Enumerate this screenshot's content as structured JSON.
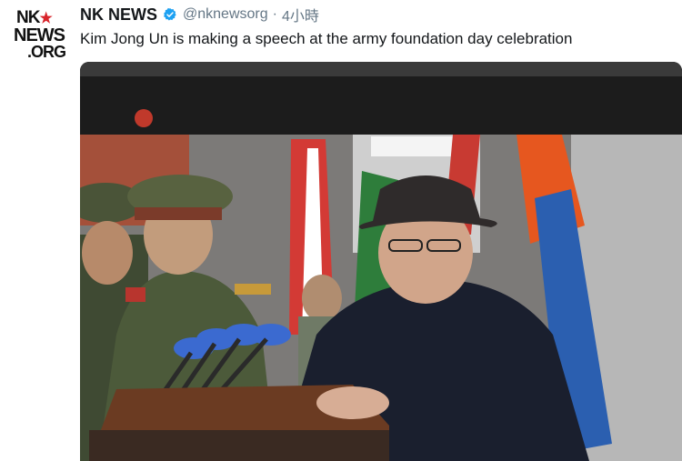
{
  "avatar": {
    "logo_line1": "NK",
    "logo_line2": "NEWS",
    "logo_line3": ".ORG",
    "star_color": "#d8242b"
  },
  "header": {
    "name": "NK NEWS",
    "handle": "@nknewsorg",
    "separator": "·",
    "time": "4小時",
    "verified_color": "#1da1f2"
  },
  "tweet": {
    "text": "Kim Jong Un is making a speech at the army foundation day celebration"
  },
  "media": {
    "icon": "photo-icon"
  }
}
